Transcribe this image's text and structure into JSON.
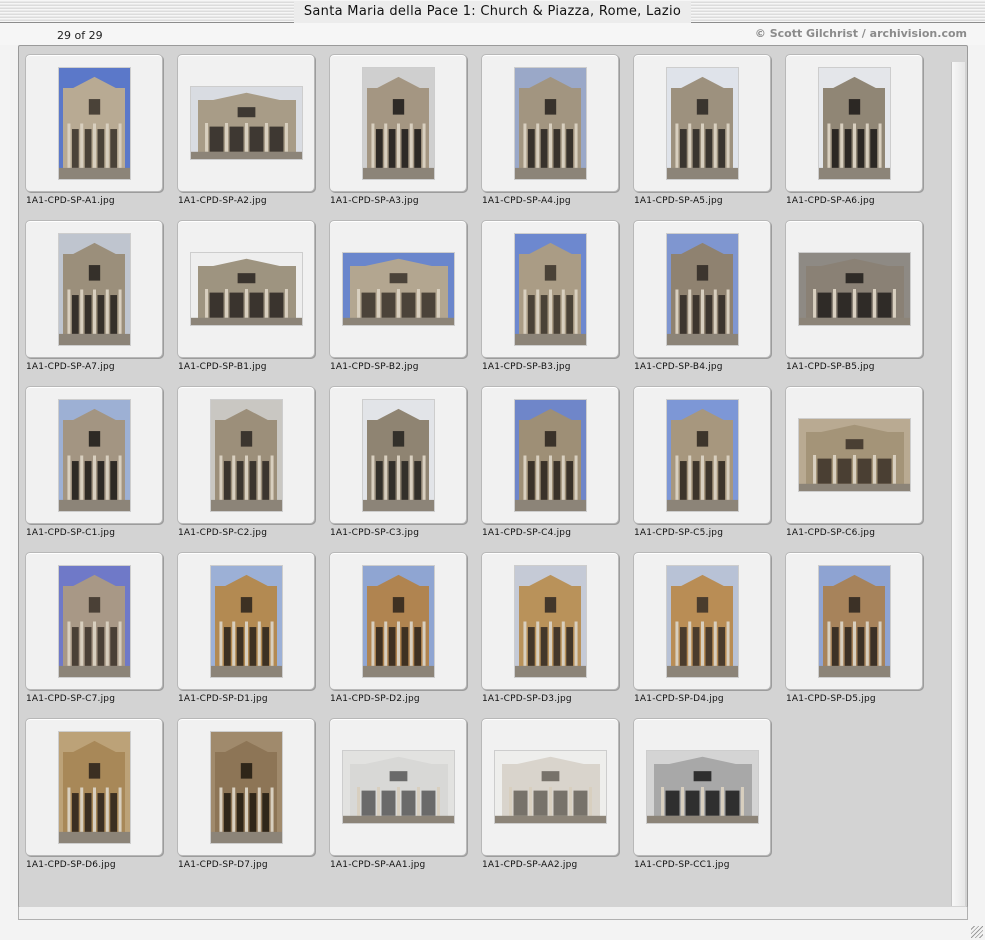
{
  "window": {
    "title": "Santa Maria della Pace 1: Church & Piazza, Rome, Lazio"
  },
  "header": {
    "count_text": "29 of 29",
    "credit": "© Scott Gilchrist / archivision.com"
  },
  "thumbnails": [
    {
      "filename": "1A1-CPD-SP-A1.jpg",
      "orientation": "portrait",
      "sky": "#5b78c9",
      "stone": "#b8aa93",
      "shade": "#4a4238"
    },
    {
      "filename": "1A1-CPD-SP-A2.jpg",
      "orientation": "landscape",
      "sky": "#d9dce2",
      "stone": "#a89c87",
      "shade": "#3e3832"
    },
    {
      "filename": "1A1-CPD-SP-A3.jpg",
      "orientation": "portrait",
      "sky": "#cfcfcf",
      "stone": "#a49682",
      "shade": "#2e2a26"
    },
    {
      "filename": "1A1-CPD-SP-A4.jpg",
      "orientation": "portrait",
      "sky": "#9aa8c8",
      "stone": "#a29580",
      "shade": "#38322c"
    },
    {
      "filename": "1A1-CPD-SP-A5.jpg",
      "orientation": "portrait",
      "sky": "#dfe3ea",
      "stone": "#9d917e",
      "shade": "#3a352f"
    },
    {
      "filename": "1A1-CPD-SP-A6.jpg",
      "orientation": "portrait",
      "sky": "#e4e6ea",
      "stone": "#908675",
      "shade": "#2c2824"
    },
    {
      "filename": "1A1-CPD-SP-A7.jpg",
      "orientation": "portrait",
      "sky": "#bfc5cf",
      "stone": "#9b8f7b",
      "shade": "#35302a"
    },
    {
      "filename": "1A1-CPD-SP-B1.jpg",
      "orientation": "landscape",
      "sky": "#eeeeee",
      "stone": "#9e9480",
      "shade": "#3a342e"
    },
    {
      "filename": "1A1-CPD-SP-B2.jpg",
      "orientation": "landscape",
      "sky": "#6a86cc",
      "stone": "#b3a690",
      "shade": "#4b4339"
    },
    {
      "filename": "1A1-CPD-SP-B3.jpg",
      "orientation": "portrait",
      "sky": "#6d88cf",
      "stone": "#aa9c85",
      "shade": "#4a4237"
    },
    {
      "filename": "1A1-CPD-SP-B4.jpg",
      "orientation": "portrait",
      "sky": "#7f96d0",
      "stone": "#8f8270",
      "shade": "#3c352e"
    },
    {
      "filename": "1A1-CPD-SP-B5.jpg",
      "orientation": "landscape",
      "sky": "#8e8a84",
      "stone": "#8a8175",
      "shade": "#2f2b27"
    },
    {
      "filename": "1A1-CPD-SP-C1.jpg",
      "orientation": "portrait",
      "sky": "#9db0d4",
      "stone": "#a39582",
      "shade": "#2e2a25"
    },
    {
      "filename": "1A1-CPD-SP-C2.jpg",
      "orientation": "portrait",
      "sky": "#c9c7c2",
      "stone": "#9c8f7a",
      "shade": "#3b352e"
    },
    {
      "filename": "1A1-CPD-SP-C3.jpg",
      "orientation": "portrait",
      "sky": "#e2e4e8",
      "stone": "#8f8472",
      "shade": "#33302a"
    },
    {
      "filename": "1A1-CPD-SP-C4.jpg",
      "orientation": "portrait",
      "sky": "#6f86c9",
      "stone": "#9e8f76",
      "shade": "#3a3229"
    },
    {
      "filename": "1A1-CPD-SP-C5.jpg",
      "orientation": "portrait",
      "sky": "#7d97d6",
      "stone": "#a7977e",
      "shade": "#3d352b"
    },
    {
      "filename": "1A1-CPD-SP-C6.jpg",
      "orientation": "landscape",
      "sky": "#b9aa92",
      "stone": "#a49478",
      "shade": "#4a3f33"
    },
    {
      "filename": "1A1-CPD-SP-C7.jpg",
      "orientation": "portrait",
      "sky": "#6f79c8",
      "stone": "#a89886",
      "shade": "#4a4036"
    },
    {
      "filename": "1A1-CPD-SP-D1.jpg",
      "orientation": "portrait",
      "sky": "#9cb0d6",
      "stone": "#b38a52",
      "shade": "#3d3123"
    },
    {
      "filename": "1A1-CPD-SP-D2.jpg",
      "orientation": "portrait",
      "sky": "#8fa5d2",
      "stone": "#b08450",
      "shade": "#3f3122"
    },
    {
      "filename": "1A1-CPD-SP-D3.jpg",
      "orientation": "portrait",
      "sky": "#c5cad6",
      "stone": "#b9925a",
      "shade": "#43372a"
    },
    {
      "filename": "1A1-CPD-SP-D4.jpg",
      "orientation": "portrait",
      "sky": "#b8c2d6",
      "stone": "#b98d55",
      "shade": "#4a3c2d"
    },
    {
      "filename": "1A1-CPD-SP-D5.jpg",
      "orientation": "portrait",
      "sky": "#8ea3d2",
      "stone": "#a7835b",
      "shade": "#3c3126"
    },
    {
      "filename": "1A1-CPD-SP-D6.jpg",
      "orientation": "portrait",
      "sky": "#bca278",
      "stone": "#a88858",
      "shade": "#3b2f22"
    },
    {
      "filename": "1A1-CPD-SP-D7.jpg",
      "orientation": "portrait",
      "sky": "#a08a6c",
      "stone": "#8d7556",
      "shade": "#2f2619"
    },
    {
      "filename": "1A1-CPD-SP-AA1.jpg",
      "orientation": "landscape",
      "sky": "#e2e2e0",
      "stone": "#d8d8d6",
      "shade": "#6a6a6a"
    },
    {
      "filename": "1A1-CPD-SP-AA2.jpg",
      "orientation": "landscape",
      "sky": "#eeeeec",
      "stone": "#d9d4cc",
      "shade": "#77726a"
    },
    {
      "filename": "1A1-CPD-SP-CC1.jpg",
      "orientation": "landscape",
      "sky": "#d4d4d4",
      "stone": "#a8a8a8",
      "shade": "#2f2f2f"
    }
  ]
}
